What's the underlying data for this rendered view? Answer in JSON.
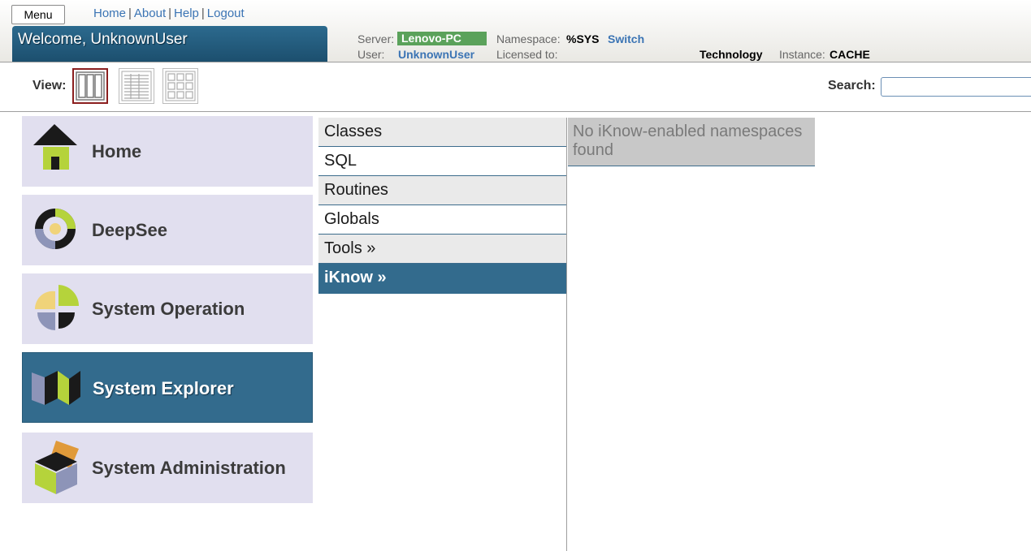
{
  "header": {
    "menu_label": "Menu",
    "links": [
      "Home",
      "About",
      "Help",
      "Logout"
    ],
    "link_separator": "|",
    "welcome": "Welcome, UnknownUser",
    "server_label": "Server:",
    "server_value": "Lenovo-PC",
    "namespace_label": "Namespace:",
    "namespace_value": "%SYS",
    "switch_label": "Switch",
    "user_label": "User:",
    "user_value": "UnknownUser",
    "licensed_label": "Licensed to:",
    "technology_value": "Technology",
    "instance_label": "Instance:",
    "instance_value": "CACHE"
  },
  "toolbar": {
    "view_label": "View:",
    "search_label": "Search:",
    "search_value": ""
  },
  "nav": {
    "items": [
      {
        "label": "Home",
        "icon": "house-icon",
        "active": false
      },
      {
        "label": "DeepSee",
        "icon": "deepsee-ring-icon",
        "active": false
      },
      {
        "label": "System Operation",
        "icon": "system-operation-icon",
        "active": false
      },
      {
        "label": "System Explorer",
        "icon": "system-explorer-icon",
        "active": true
      },
      {
        "label": "System Administration",
        "icon": "system-administration-box-icon",
        "active": false
      }
    ]
  },
  "submenu": {
    "items": [
      {
        "label": "Classes"
      },
      {
        "label": "SQL"
      },
      {
        "label": "Routines"
      },
      {
        "label": "Globals"
      },
      {
        "label": "Tools »"
      },
      {
        "label": "iKnow »",
        "active": true
      }
    ]
  },
  "detail": {
    "message": "No iKnow-enabled namespaces found"
  },
  "colors": {
    "accent": "#336b8d",
    "server_badge": "#5ba25b",
    "nav_bg": "#e1dfef",
    "link": "#3b74b4"
  }
}
